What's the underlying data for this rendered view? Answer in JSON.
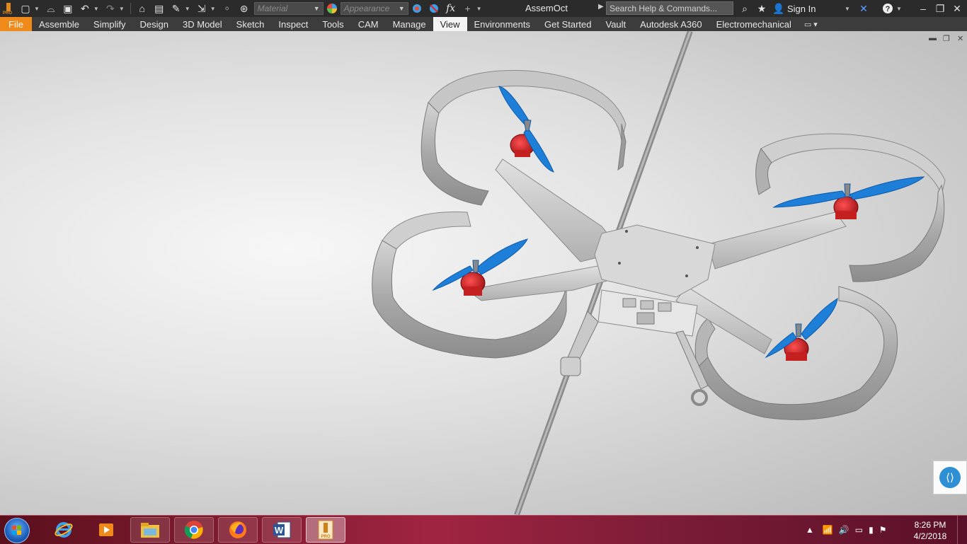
{
  "window": {
    "title": "AssemOct",
    "search_placeholder": "Search Help & Commands...",
    "sign_in": "Sign In"
  },
  "quick_access": {
    "material_placeholder": "Material",
    "appearance_placeholder": "Appearance",
    "fx_label": "fx"
  },
  "ribbon": {
    "tabs": [
      {
        "label": "File"
      },
      {
        "label": "Assemble"
      },
      {
        "label": "Simplify"
      },
      {
        "label": "Design"
      },
      {
        "label": "3D Model"
      },
      {
        "label": "Sketch"
      },
      {
        "label": "Inspect"
      },
      {
        "label": "Tools"
      },
      {
        "label": "CAM"
      },
      {
        "label": "Manage"
      },
      {
        "label": "View"
      },
      {
        "label": "Environments"
      },
      {
        "label": "Get Started"
      },
      {
        "label": "Vault"
      },
      {
        "label": "Autodesk A360"
      },
      {
        "label": "Electromechanical"
      }
    ],
    "active_tab": "View"
  },
  "colors": {
    "file_tab": "#f08a1a",
    "propeller": "#1e7fd8",
    "motor": "#c0161c",
    "frame": "#c8c8c8"
  },
  "taskbar": {
    "apps": [
      {
        "name": "internet-explorer",
        "state": "normal"
      },
      {
        "name": "media-player",
        "state": "normal"
      },
      {
        "name": "file-explorer",
        "state": "open"
      },
      {
        "name": "chrome",
        "state": "open"
      },
      {
        "name": "firefox",
        "state": "open"
      },
      {
        "name": "word",
        "state": "open"
      },
      {
        "name": "inventor",
        "state": "active"
      }
    ],
    "time": "8:26 PM",
    "date": "4/2/2018"
  }
}
